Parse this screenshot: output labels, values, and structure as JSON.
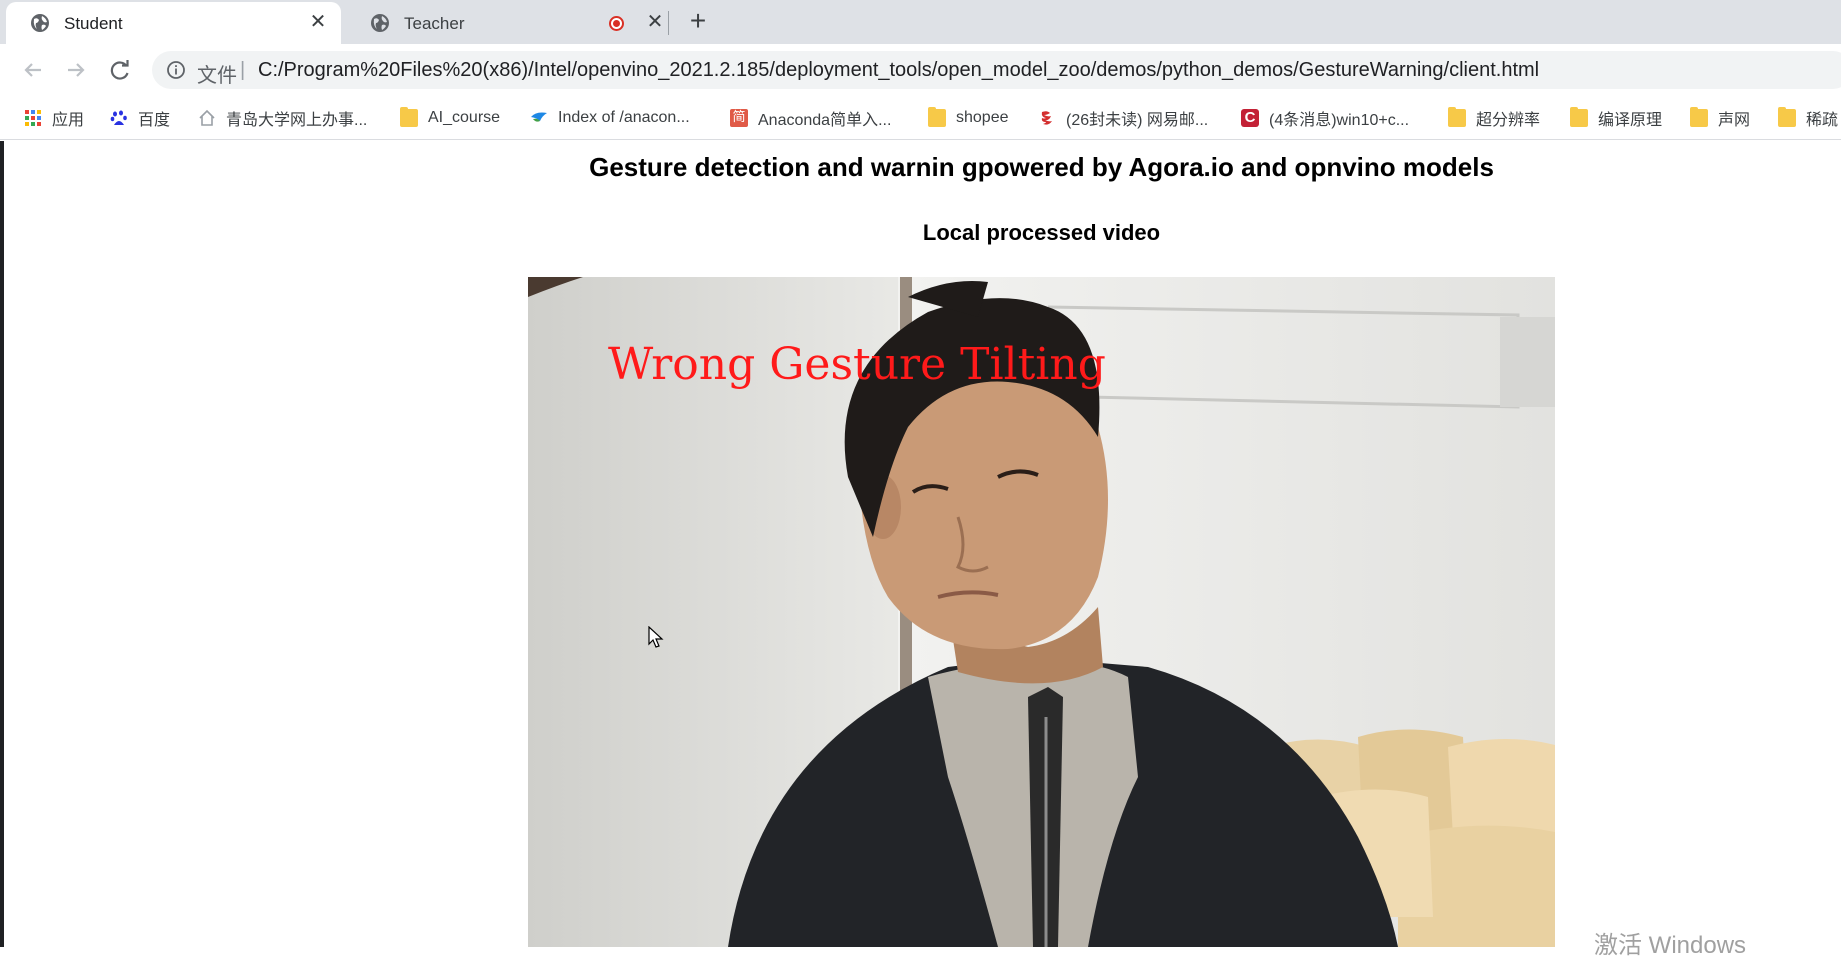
{
  "tabs": [
    {
      "label": "Student",
      "active": true,
      "icon": "globe-icon"
    },
    {
      "label": "Teacher",
      "active": false,
      "icon": "globe-icon",
      "recording": true
    }
  ],
  "toolbar": {
    "url_scheme": "文件",
    "url_divider": "|",
    "url": "C:/Program%20Files%20(x86)/Intel/openvino_2021.2.185/deployment_tools/open_model_zoo/demos/python_demos/GestureWarning/client.html"
  },
  "bookmarks": [
    {
      "label": "应用",
      "icon": "apps-grid-icon"
    },
    {
      "label": "百度",
      "icon": "baidu-paw-icon"
    },
    {
      "label": "青岛大学网上办事...",
      "icon": "home-icon"
    },
    {
      "label": "AI_course",
      "icon": "folder-icon"
    },
    {
      "label": "Index of /anacon...",
      "icon": "bird-icon"
    },
    {
      "label": "Anaconda简单入...",
      "icon": "jian-icon"
    },
    {
      "label": "shopee",
      "icon": "folder-icon"
    },
    {
      "label": "(26封未读) 网易邮...",
      "icon": "netease-icon"
    },
    {
      "label": "(4条消息)win10+c...",
      "icon": "csdn-icon"
    },
    {
      "label": "超分辨率",
      "icon": "folder-icon"
    },
    {
      "label": "编译原理",
      "icon": "folder-icon"
    },
    {
      "label": "声网",
      "icon": "folder-icon"
    },
    {
      "label": "稀疏",
      "icon": "folder-icon"
    }
  ],
  "page": {
    "heading": "Gesture detection and warnin gpowered by Agora.io and opnvino models",
    "subheading": "Local processed video",
    "video_overlay_text": "Wrong Gesture Tilting"
  },
  "watermark": "激活 Windows",
  "colors": {
    "tabstrip": "#dee1e6",
    "omnibox": "#f1f3f4",
    "overlay_text": "#ff1a1a",
    "record_dot": "#d93025"
  }
}
